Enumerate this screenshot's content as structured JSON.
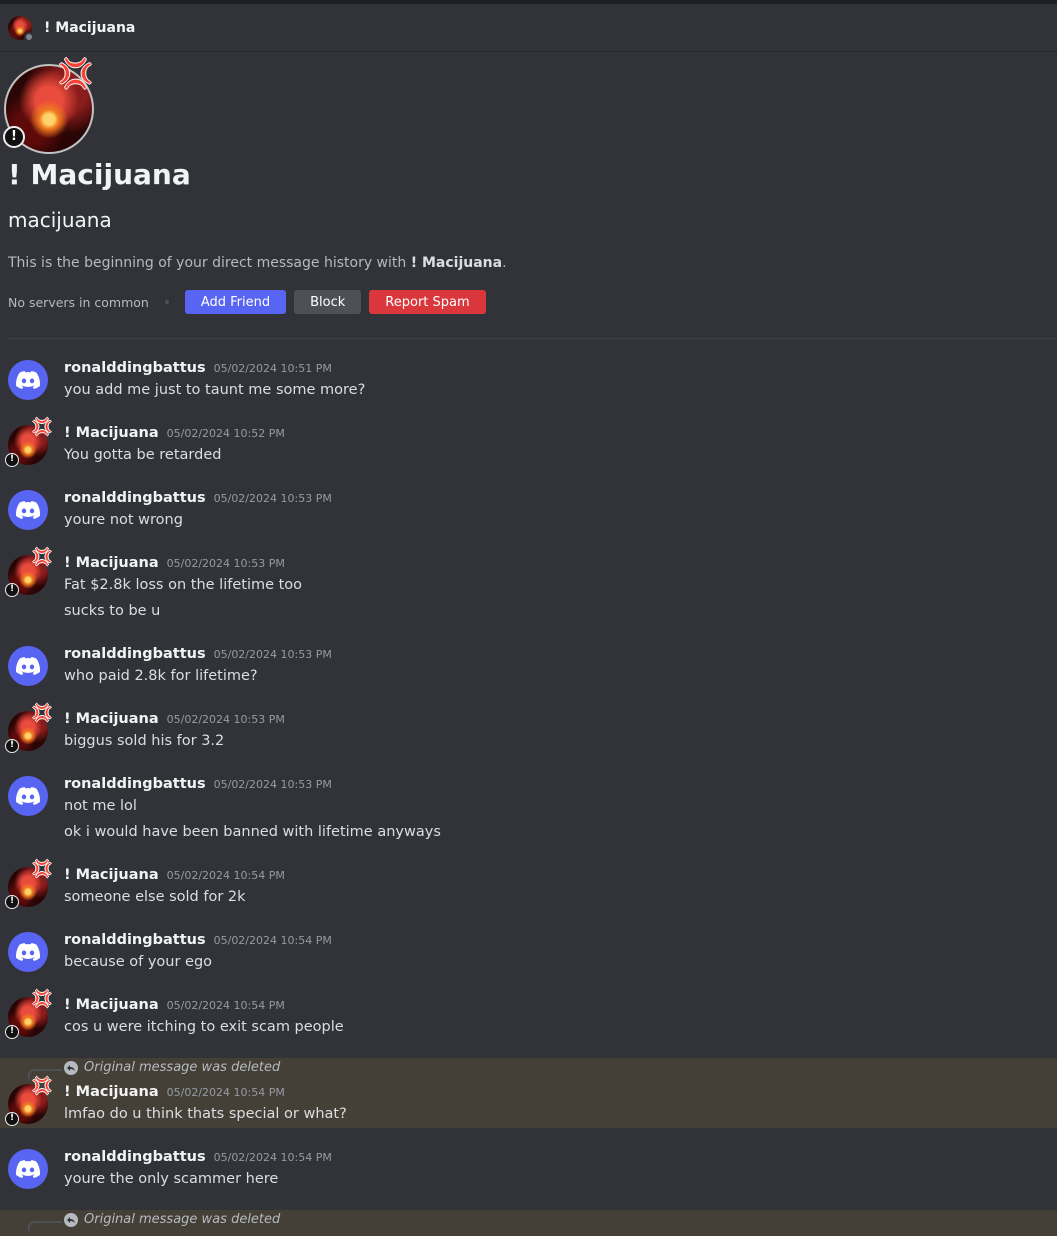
{
  "header": {
    "title": "! Macijuana",
    "status_icon": "offline-dot"
  },
  "profile": {
    "display_name": "! Macijuana",
    "username": "macijuana",
    "beginning_prefix": "This is the beginning of your direct message history with ",
    "beginning_name": "! Macijuana",
    "beginning_suffix": ".",
    "no_servers": "No servers in common",
    "add_friend": "Add Friend",
    "block": "Block",
    "report_spam": "Report Spam",
    "badge_glyph": "!",
    "anger_glyph": "💢"
  },
  "colors": {
    "background": "#313338",
    "blurple": "#5865f2",
    "danger": "#da373c",
    "highlight": "#444037"
  },
  "reply_text": "Original message was deleted",
  "messages": [
    {
      "author": "ronalddingbattus",
      "time": "05/02/2024 10:51 PM",
      "lines": [
        "you add me just to taunt me some more?"
      ]
    },
    {
      "author": "! Macijuana",
      "time": "05/02/2024 10:52 PM",
      "lines": [
        "You gotta be retarded"
      ]
    },
    {
      "author": "ronalddingbattus",
      "time": "05/02/2024 10:53 PM",
      "lines": [
        "youre not wrong"
      ]
    },
    {
      "author": "! Macijuana",
      "time": "05/02/2024 10:53 PM",
      "lines": [
        "Fat $2.8k loss on the lifetime too",
        "sucks to be u"
      ]
    },
    {
      "author": "ronalddingbattus",
      "time": "05/02/2024 10:53 PM",
      "lines": [
        "who paid 2.8k for lifetime?"
      ]
    },
    {
      "author": "! Macijuana",
      "time": "05/02/2024 10:53 PM",
      "lines": [
        "biggus sold his for 3.2"
      ]
    },
    {
      "author": "ronalddingbattus",
      "time": "05/02/2024 10:53 PM",
      "lines": [
        "not me lol",
        "ok i would have been banned with lifetime anyways"
      ]
    },
    {
      "author": "! Macijuana",
      "time": "05/02/2024 10:54 PM",
      "lines": [
        "someone else sold for 2k"
      ]
    },
    {
      "author": "ronalddingbattus",
      "time": "05/02/2024 10:54 PM",
      "lines": [
        "because of your ego"
      ]
    },
    {
      "author": "! Macijuana",
      "time": "05/02/2024 10:54 PM",
      "lines": [
        "cos u were itching to exit scam people"
      ]
    },
    {
      "author": "! Macijuana",
      "time": "05/02/2024 10:54 PM",
      "lines": [
        "lmfao do u think thats special or what?"
      ]
    },
    {
      "author": "ronalddingbattus",
      "time": "05/02/2024 10:54 PM",
      "lines": [
        "youre the only scammer here"
      ]
    }
  ]
}
